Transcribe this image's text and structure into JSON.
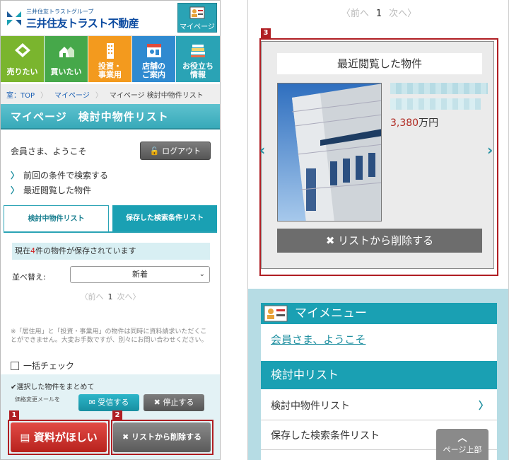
{
  "header": {
    "logo_sub": "三井住友トラストグループ",
    "logo_main": "三井住友トラスト不動産",
    "mypage_label": "マイページ"
  },
  "nav": [
    {
      "label": "売りたい",
      "color": "#7ab52e"
    },
    {
      "label": "買いたい",
      "color": "#46a84a"
    },
    {
      "label": "投資・\n事業用",
      "color": "#f39a1e"
    },
    {
      "label": "店舗の\nご案内",
      "color": "#2f8ad0"
    },
    {
      "label": "お役立ち\n情報",
      "color": "#2aa3b5"
    }
  ],
  "breadcrumb": {
    "home": "室：TOP",
    "mypage": "マイページ",
    "current": "マイページ 検討中物件リスト"
  },
  "page_title": "マイページ　検討中物件リスト",
  "welcome": "会員さま、ようこそ",
  "logout_label": "ログアウト",
  "links": [
    "前回の条件で検索する",
    "最近閲覧した物件"
  ],
  "tabs": {
    "active": "検討中物件リスト",
    "inactive": "保存した検索条件リスト"
  },
  "saved_info": {
    "prefix": "現在",
    "count": "4",
    "suffix": "件の物件が保存されています"
  },
  "sort": {
    "label": "並べ替え:",
    "value": "新着"
  },
  "pager": {
    "prev": "〈前へ",
    "current": "1",
    "next": "次へ〉"
  },
  "note": "※「居住用」と「投資・事業用」の物件は同時に資料請求いただくことができません。大変お手数ですが、別々にお問い合わせください。",
  "check_all_label": "一括チェック",
  "bulk": {
    "label": "✔選択した物件をまとめて",
    "price_mail_label": "価格変更メールを",
    "receive_label": "受信する",
    "stop_label": "停止する"
  },
  "request_button": {
    "label": "資料がほしい",
    "badge": "1"
  },
  "delete_button": {
    "label": "リストから削除する",
    "badge": "2"
  },
  "carousel": {
    "badge": "3",
    "title": "最近閲覧した物件",
    "price_value": "3,380",
    "price_unit": "万円",
    "delete_label": "リストから削除する"
  },
  "mymenu": {
    "title": "マイメニュー",
    "welcome": "会員さま、ようこそ",
    "list_head": "検討中リスト",
    "items": [
      "検討中物件リスト",
      "保存した検索条件リスト"
    ]
  },
  "page_top_label": "ページ上部",
  "colors": {
    "accent": "#1aa0b3",
    "badge": "#b01e23",
    "price": "#b02a22"
  }
}
